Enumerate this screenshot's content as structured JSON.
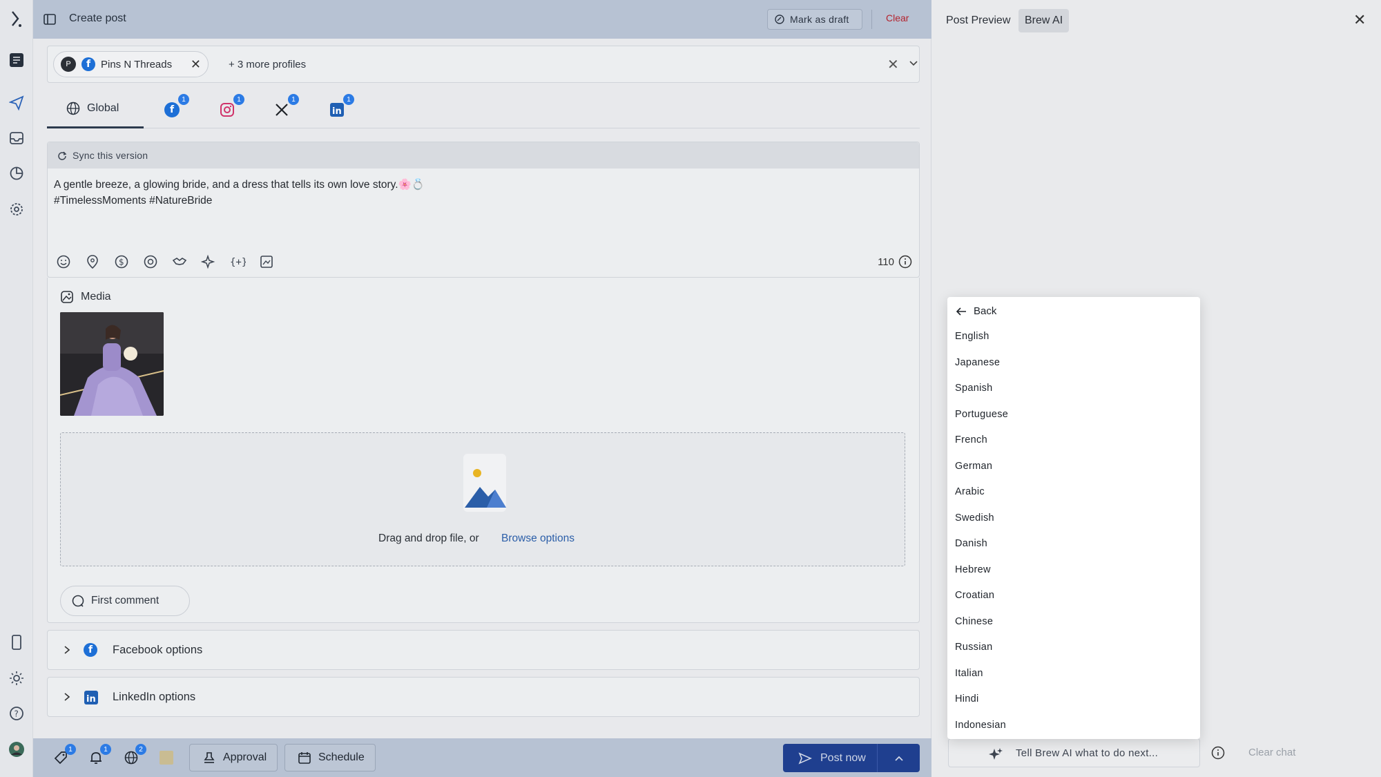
{
  "editor": {
    "title": "Create post",
    "mark_draft": "Mark as draft",
    "clear": "Clear",
    "profile_chip": "Pins N Threads",
    "more_profiles": "+ 3 more profiles",
    "global_tab": "Global",
    "badges": {
      "facebook": "1",
      "instagram": "1",
      "x": "1",
      "linkedin": "1"
    },
    "sync_label": "Sync this version",
    "post_text_line1": "A gentle breeze, a glowing bride, and a dress that tells its own love story.🌸💍",
    "post_text_line2": "#TimelessMoments #NatureBride",
    "char_count": "110",
    "media_title": "Media",
    "drag_text": "Drag and drop file, or",
    "browse_link": "Browse options",
    "first_comment": "First comment",
    "facebook_options": "Facebook options",
    "linkedin_options": "LinkedIn options"
  },
  "bottom_bar": {
    "badge_tag": "1",
    "badge_bell": "1",
    "badge_globe": "2",
    "approval": "Approval",
    "schedule": "Schedule",
    "post_now": "Post now"
  },
  "right_panel": {
    "tab_preview": "Post Preview",
    "tab_brew": "Brew AI",
    "ai_placeholder": "Tell Brew AI what to do next...",
    "clear_chat": "Clear chat"
  },
  "dropdown": {
    "back": "Back",
    "languages": [
      "English",
      "Japanese",
      "Spanish",
      "Portuguese",
      "French",
      "German",
      "Arabic",
      "Swedish",
      "Danish",
      "Hebrew",
      "Croatian",
      "Chinese",
      "Russian",
      "Italian",
      "Hindi",
      "Indonesian"
    ]
  },
  "colors": {
    "accent": "#1f3f8f",
    "danger": "#b4232e",
    "badge": "#2c7be5"
  }
}
